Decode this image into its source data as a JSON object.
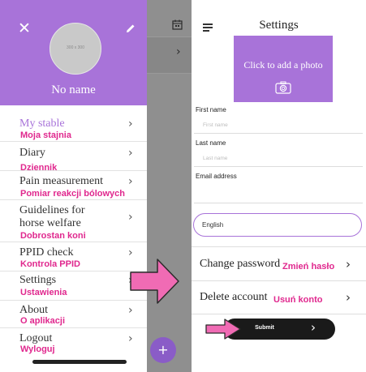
{
  "drawer": {
    "close_icon": "close-icon",
    "edit_icon": "pencil-icon",
    "avatar_placeholder": "300 x 300",
    "name": "No name",
    "items": [
      {
        "label": "My stable",
        "pl_label": "Moja stajnia",
        "active": true
      },
      {
        "label": "Diary",
        "pl_label": "Dziennik"
      },
      {
        "label": "Pain measurement",
        "pl_label": "Pomiar reakcji bólowych"
      },
      {
        "label": "Guidelines for",
        "label2": "horse welfare",
        "pl_label": "Dobrostan koni"
      },
      {
        "label": "PPID check",
        "pl_label": "Kontrola PPID"
      },
      {
        "label": "Settings",
        "pl_label": "Ustawienia"
      },
      {
        "label": "About",
        "pl_label": "O aplikacji"
      },
      {
        "label": "Logout",
        "pl_label": "Wyloguj"
      }
    ],
    "fab_label": "+"
  },
  "settings": {
    "title": "Settings",
    "photo_text": "Click to add a photo",
    "fields": {
      "first_name_label": "First name",
      "first_name_placeholder": "First name",
      "last_name_label": "Last name",
      "last_name_placeholder": "Last name",
      "email_label": "Email address",
      "email_value": ""
    },
    "language": "English",
    "change_password": {
      "label": "Change password",
      "pl_label": "Zmień hasło"
    },
    "delete_account": {
      "label": "Delete account",
      "pl_label": "Usuń konto"
    },
    "submit_label": "Submit"
  },
  "colors": {
    "accent": "#a873d9",
    "annotation": "#e0288e",
    "arrow_fill": "#f06bb4",
    "dark_button": "#1a1a1a"
  }
}
